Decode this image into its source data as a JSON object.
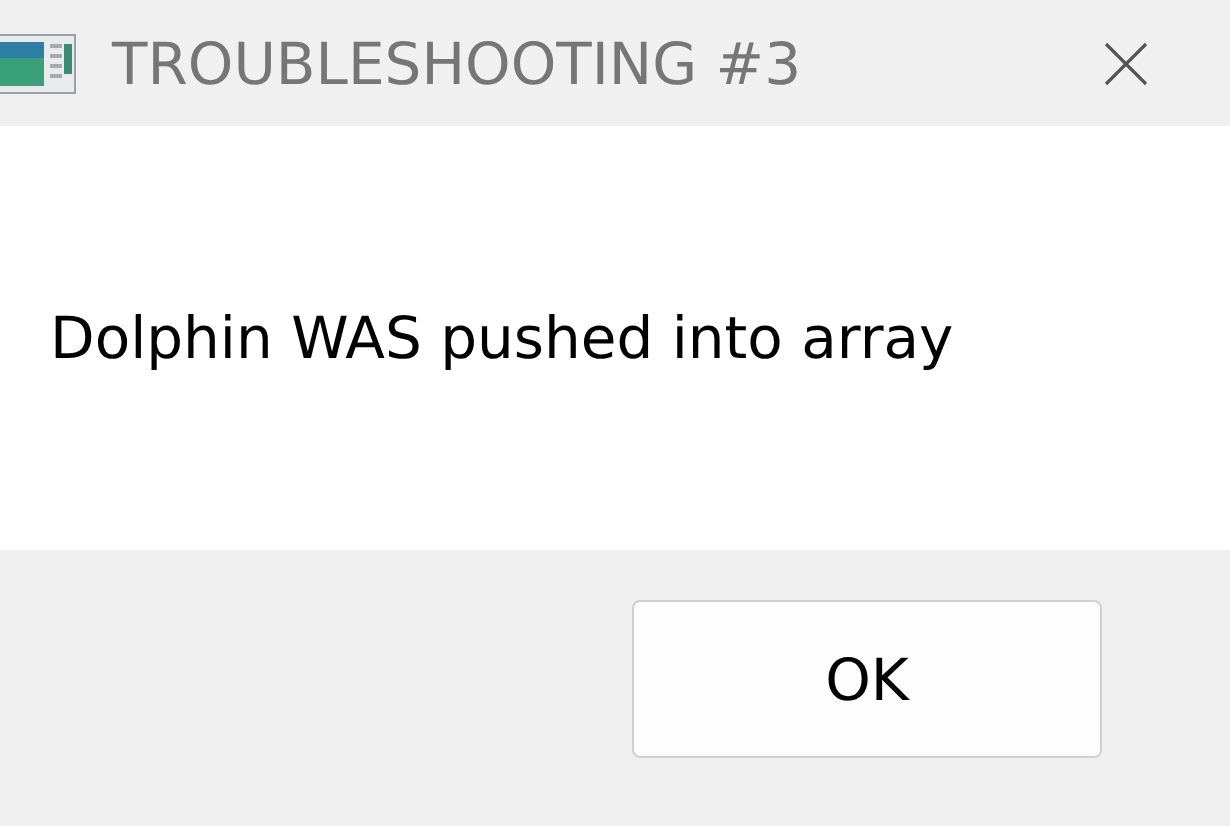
{
  "window": {
    "title": "TROUBLESHOOTING #3"
  },
  "message": "Dolphin WAS pushed into array",
  "buttons": [
    "OK"
  ]
}
